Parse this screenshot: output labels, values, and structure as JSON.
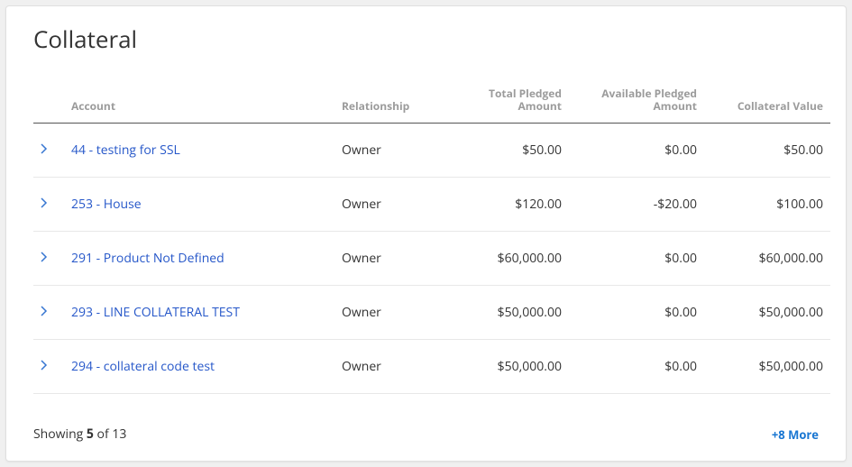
{
  "title": "Collateral",
  "columns": {
    "account": "Account",
    "relationship": "Relationship",
    "total_pledged": "Total Pledged Amount",
    "available_pledged": "Available Pledged Amount",
    "collateral_value": "Collateral Value"
  },
  "rows": [
    {
      "account": "44 - testing for SSL",
      "relationship": "Owner",
      "total_pledged": "$50.00",
      "available_pledged": "$0.00",
      "collateral_value": "$50.00"
    },
    {
      "account": "253 - House",
      "relationship": "Owner",
      "total_pledged": "$120.00",
      "available_pledged": "-$20.00",
      "collateral_value": "$100.00"
    },
    {
      "account": "291 - Product Not Defined",
      "relationship": "Owner",
      "total_pledged": "$60,000.00",
      "available_pledged": "$0.00",
      "collateral_value": "$60,000.00"
    },
    {
      "account": "293 - LINE COLLATERAL TEST",
      "relationship": "Owner",
      "total_pledged": "$50,000.00",
      "available_pledged": "$0.00",
      "collateral_value": "$50,000.00"
    },
    {
      "account": "294 - collateral code test",
      "relationship": "Owner",
      "total_pledged": "$50,000.00",
      "available_pledged": "$0.00",
      "collateral_value": "$50,000.00"
    }
  ],
  "footer": {
    "showing_prefix": "Showing ",
    "showing_count": "5",
    "showing_middle": " of ",
    "showing_total": "13",
    "more_link": "+8 More"
  }
}
